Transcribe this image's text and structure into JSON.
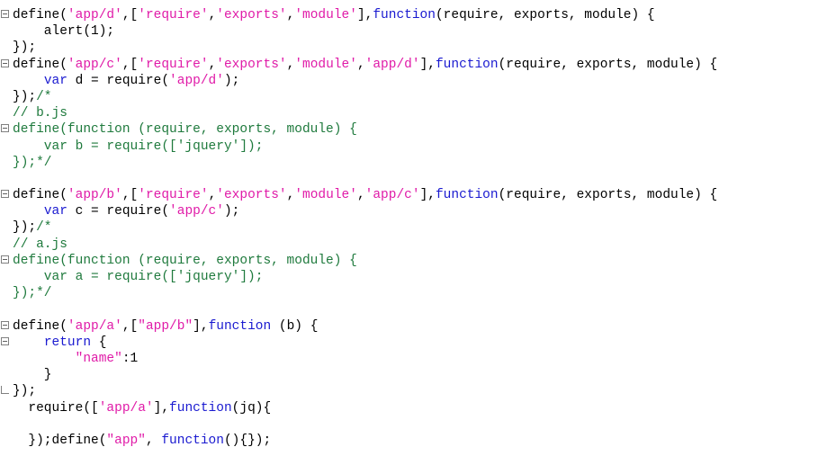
{
  "editor": {
    "name": "code-editor",
    "language": "javascript",
    "background": "#ffffff",
    "colors": {
      "plain": "#000000",
      "keyword": "#1a1ad0",
      "string": "#e01ba8",
      "comment": "#1f7a3d",
      "number": "#000000"
    },
    "lines": [
      {
        "fold": "open",
        "tokens": [
          {
            "t": "define(",
            "c": "plain"
          },
          {
            "t": "'app/d'",
            "c": "string"
          },
          {
            "t": ",[",
            "c": "plain"
          },
          {
            "t": "'require'",
            "c": "string"
          },
          {
            "t": ",",
            "c": "plain"
          },
          {
            "t": "'exports'",
            "c": "string"
          },
          {
            "t": ",",
            "c": "plain"
          },
          {
            "t": "'module'",
            "c": "string"
          },
          {
            "t": "],",
            "c": "plain"
          },
          {
            "t": "function",
            "c": "keyword"
          },
          {
            "t": "(require, exports, module) {",
            "c": "plain"
          }
        ]
      },
      {
        "fold": "none",
        "tokens": [
          {
            "t": "    alert(",
            "c": "plain"
          },
          {
            "t": "1",
            "c": "number"
          },
          {
            "t": ");",
            "c": "plain"
          }
        ]
      },
      {
        "fold": "none",
        "tokens": [
          {
            "t": "});",
            "c": "plain"
          }
        ]
      },
      {
        "fold": "open",
        "tokens": [
          {
            "t": "define(",
            "c": "plain"
          },
          {
            "t": "'app/c'",
            "c": "string"
          },
          {
            "t": ",[",
            "c": "plain"
          },
          {
            "t": "'require'",
            "c": "string"
          },
          {
            "t": ",",
            "c": "plain"
          },
          {
            "t": "'exports'",
            "c": "string"
          },
          {
            "t": ",",
            "c": "plain"
          },
          {
            "t": "'module'",
            "c": "string"
          },
          {
            "t": ",",
            "c": "plain"
          },
          {
            "t": "'app/d'",
            "c": "string"
          },
          {
            "t": "],",
            "c": "plain"
          },
          {
            "t": "function",
            "c": "keyword"
          },
          {
            "t": "(require, exports, module) {",
            "c": "plain"
          }
        ]
      },
      {
        "fold": "none",
        "tokens": [
          {
            "t": "    ",
            "c": "plain"
          },
          {
            "t": "var",
            "c": "keyword"
          },
          {
            "t": " d = require(",
            "c": "plain"
          },
          {
            "t": "'app/d'",
            "c": "string"
          },
          {
            "t": ");",
            "c": "plain"
          }
        ]
      },
      {
        "fold": "none",
        "tokens": [
          {
            "t": "});",
            "c": "plain"
          },
          {
            "t": "/*",
            "c": "comment"
          }
        ]
      },
      {
        "fold": "none",
        "tokens": [
          {
            "t": "// b.js",
            "c": "comment"
          }
        ]
      },
      {
        "fold": "open",
        "tokens": [
          {
            "t": "define(function (require, exports, module) {",
            "c": "comment"
          }
        ]
      },
      {
        "fold": "none",
        "tokens": [
          {
            "t": "    var b = require(['jquery']);",
            "c": "comment"
          }
        ]
      },
      {
        "fold": "none",
        "tokens": [
          {
            "t": "});*/",
            "c": "comment"
          }
        ]
      },
      {
        "fold": "none",
        "tokens": []
      },
      {
        "fold": "open",
        "tokens": [
          {
            "t": "define(",
            "c": "plain"
          },
          {
            "t": "'app/b'",
            "c": "string"
          },
          {
            "t": ",[",
            "c": "plain"
          },
          {
            "t": "'require'",
            "c": "string"
          },
          {
            "t": ",",
            "c": "plain"
          },
          {
            "t": "'exports'",
            "c": "string"
          },
          {
            "t": ",",
            "c": "plain"
          },
          {
            "t": "'module'",
            "c": "string"
          },
          {
            "t": ",",
            "c": "plain"
          },
          {
            "t": "'app/c'",
            "c": "string"
          },
          {
            "t": "],",
            "c": "plain"
          },
          {
            "t": "function",
            "c": "keyword"
          },
          {
            "t": "(require, exports, module) {",
            "c": "plain"
          }
        ]
      },
      {
        "fold": "none",
        "tokens": [
          {
            "t": "    ",
            "c": "plain"
          },
          {
            "t": "var",
            "c": "keyword"
          },
          {
            "t": " c = require(",
            "c": "plain"
          },
          {
            "t": "'app/c'",
            "c": "string"
          },
          {
            "t": ");",
            "c": "plain"
          }
        ]
      },
      {
        "fold": "none",
        "tokens": [
          {
            "t": "});",
            "c": "plain"
          },
          {
            "t": "/*",
            "c": "comment"
          }
        ]
      },
      {
        "fold": "none",
        "tokens": [
          {
            "t": "// a.js",
            "c": "comment"
          }
        ]
      },
      {
        "fold": "open",
        "tokens": [
          {
            "t": "define(function (require, exports, module) {",
            "c": "comment"
          }
        ]
      },
      {
        "fold": "none",
        "tokens": [
          {
            "t": "    var a = require(['jquery']);",
            "c": "comment"
          }
        ]
      },
      {
        "fold": "none",
        "tokens": [
          {
            "t": "});*/",
            "c": "comment"
          }
        ]
      },
      {
        "fold": "none",
        "tokens": []
      },
      {
        "fold": "open",
        "tokens": [
          {
            "t": "define(",
            "c": "plain"
          },
          {
            "t": "'app/a'",
            "c": "string"
          },
          {
            "t": ",[",
            "c": "plain"
          },
          {
            "t": "\"app/b\"",
            "c": "string"
          },
          {
            "t": "],",
            "c": "plain"
          },
          {
            "t": "function",
            "c": "keyword"
          },
          {
            "t": " (b) {",
            "c": "plain"
          }
        ]
      },
      {
        "fold": "open",
        "tokens": [
          {
            "t": "    ",
            "c": "plain"
          },
          {
            "t": "return",
            "c": "keyword"
          },
          {
            "t": " {",
            "c": "plain"
          }
        ]
      },
      {
        "fold": "none",
        "tokens": [
          {
            "t": "        ",
            "c": "plain"
          },
          {
            "t": "\"name\"",
            "c": "string"
          },
          {
            "t": ":",
            "c": "plain"
          },
          {
            "t": "1",
            "c": "number"
          }
        ]
      },
      {
        "fold": "none",
        "tokens": [
          {
            "t": "    }",
            "c": "plain"
          }
        ]
      },
      {
        "fold": "close",
        "tokens": [
          {
            "t": "});",
            "c": "plain"
          }
        ]
      },
      {
        "fold": "none",
        "tokens": [
          {
            "t": "  require([",
            "c": "plain"
          },
          {
            "t": "'app/a'",
            "c": "string"
          },
          {
            "t": "],",
            "c": "plain"
          },
          {
            "t": "function",
            "c": "keyword"
          },
          {
            "t": "(jq){",
            "c": "plain"
          }
        ]
      },
      {
        "fold": "none",
        "tokens": []
      },
      {
        "fold": "none",
        "tokens": [
          {
            "t": "  });define(",
            "c": "plain"
          },
          {
            "t": "\"app\"",
            "c": "string"
          },
          {
            "t": ", ",
            "c": "plain"
          },
          {
            "t": "function",
            "c": "keyword"
          },
          {
            "t": "(){});",
            "c": "plain"
          }
        ]
      }
    ]
  }
}
